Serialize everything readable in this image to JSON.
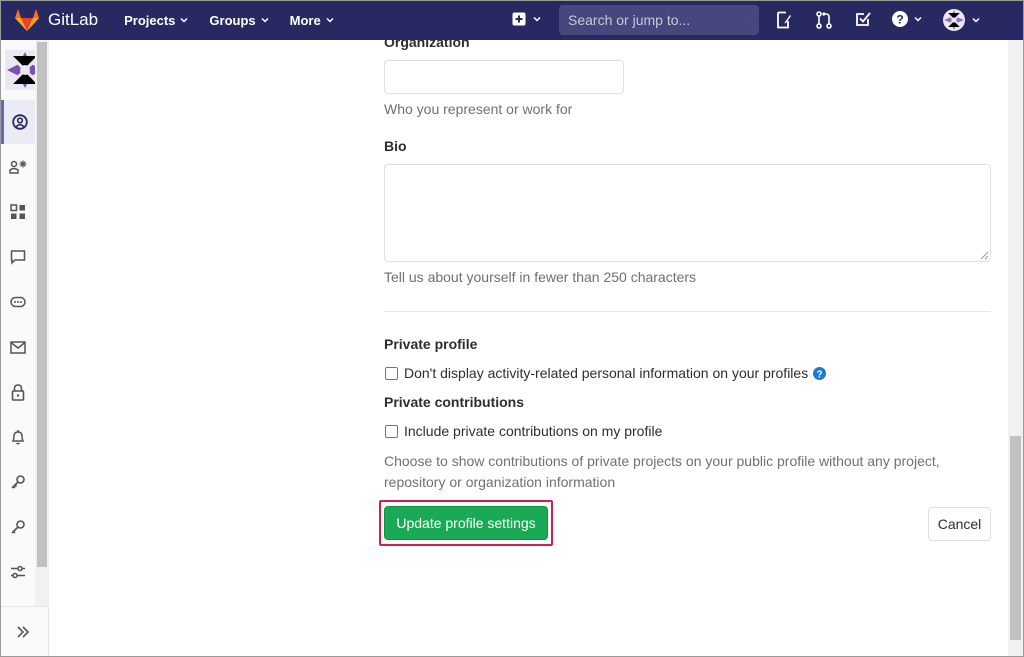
{
  "navbar": {
    "brand": "GitLab",
    "menu": [
      {
        "label": "Projects"
      },
      {
        "label": "Groups"
      },
      {
        "label": "More"
      }
    ],
    "search_placeholder": "Search or jump to...",
    "background": "#292961"
  },
  "form": {
    "organization_label": "Organization",
    "organization_value": "",
    "organization_help": "Who you represent or work for",
    "bio_label": "Bio",
    "bio_value": "",
    "bio_help": "Tell us about yourself in fewer than 250 characters",
    "private_profile_label": "Private profile",
    "private_profile_checkbox": "Don't display activity-related personal information on your profiles",
    "private_profile_checked": false,
    "private_contrib_label": "Private contributions",
    "private_contrib_checkbox": "Include private contributions on my profile",
    "private_contrib_checked": false,
    "private_contrib_help": "Choose to show contributions of private projects on your public profile without any project, repository or organization information",
    "submit_label": "Update profile settings",
    "cancel_label": "Cancel"
  },
  "colors": {
    "primary_green": "#1aaa55",
    "highlight": "#d31e50",
    "help_icon": "#1f78d1"
  },
  "sidebar_icons": [
    "profile-icon",
    "account-icon",
    "applications-icon",
    "chat-icon",
    "access-tokens-icon",
    "emails-icon",
    "password-icon",
    "notifications-icon",
    "ssh-keys-icon",
    "gpg-keys-icon",
    "preferences-icon"
  ]
}
